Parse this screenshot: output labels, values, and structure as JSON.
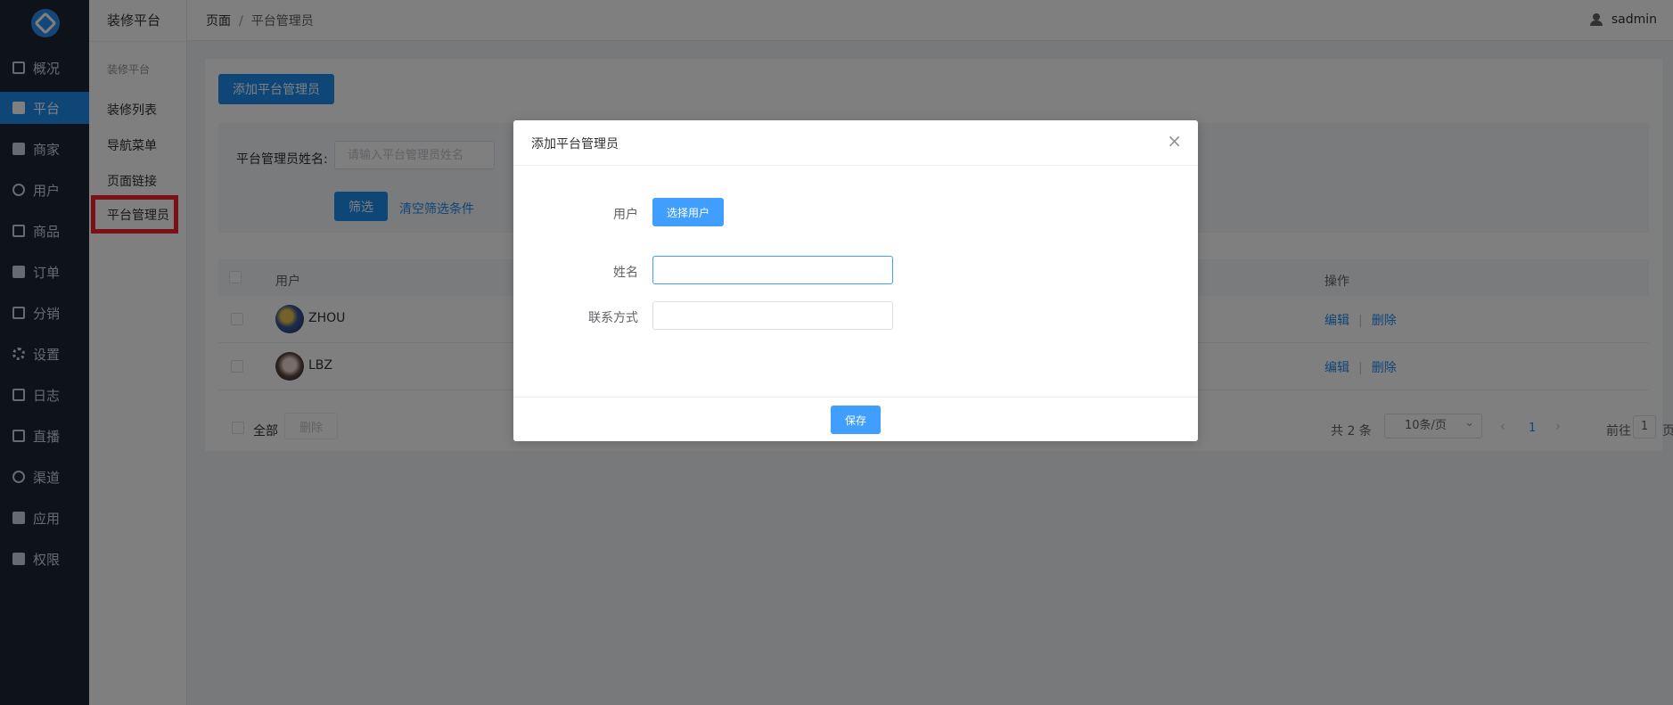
{
  "nav": {
    "items": [
      {
        "label": "概况",
        "icon": "monitor-icon"
      },
      {
        "label": "平台",
        "icon": "desktop-icon"
      },
      {
        "label": "商家",
        "icon": "store-icon"
      },
      {
        "label": "用户",
        "icon": "user-icon"
      },
      {
        "label": "商品",
        "icon": "goods-icon"
      },
      {
        "label": "订单",
        "icon": "clipboard-icon"
      },
      {
        "label": "分销",
        "icon": "hierarchy-icon"
      },
      {
        "label": "设置",
        "icon": "gear-icon"
      },
      {
        "label": "日志",
        "icon": "book-icon"
      },
      {
        "label": "直播",
        "icon": "live-icon"
      },
      {
        "label": "渠道",
        "icon": "channels-icon"
      },
      {
        "label": "应用",
        "icon": "apps-icon"
      },
      {
        "label": "权限",
        "icon": "lock-icon"
      }
    ],
    "active_index": 1,
    "accent": "#1f8cf0",
    "background": "#1d2735"
  },
  "submenu": {
    "title": "装修平台",
    "group": "装修平台",
    "items": [
      "装修列表",
      "导航菜单",
      "页面链接",
      "平台管理员"
    ],
    "highlight_color": "#f5222d"
  },
  "header": {
    "breadcrumb": [
      "页面",
      "平台管理员"
    ],
    "breadcrumb_sep": "/",
    "username": "sadmin"
  },
  "main": {
    "add_button": "添加平台管理员",
    "filter": {
      "label": "平台管理员姓名:",
      "placeholder": "请输入平台管理员姓名",
      "submit": "筛选",
      "clear": "清空筛选条件"
    },
    "table": {
      "columns": [
        "用户",
        "操作"
      ],
      "rows": [
        {
          "name": "ZHOU",
          "edit": "编辑",
          "delete": "删除"
        },
        {
          "name": "LBZ",
          "edit": "编辑",
          "delete": "删除"
        }
      ],
      "op_sep": "|"
    },
    "footer": {
      "select_all": "全部",
      "delete": "删除",
      "total": "共 2 条",
      "page_size": "10条/页",
      "current_page": "1",
      "goto_prefix": "前往",
      "goto_value": "1",
      "goto_suffix": "页",
      "prev": "‹",
      "next": "›"
    }
  },
  "modal": {
    "title": "添加平台管理员",
    "close": "×",
    "fields": {
      "user_label": "用户",
      "user_button": "选择用户",
      "name_label": "姓名",
      "name_value": "",
      "contact_label": "联系方式",
      "contact_value": ""
    },
    "save": "保存"
  }
}
